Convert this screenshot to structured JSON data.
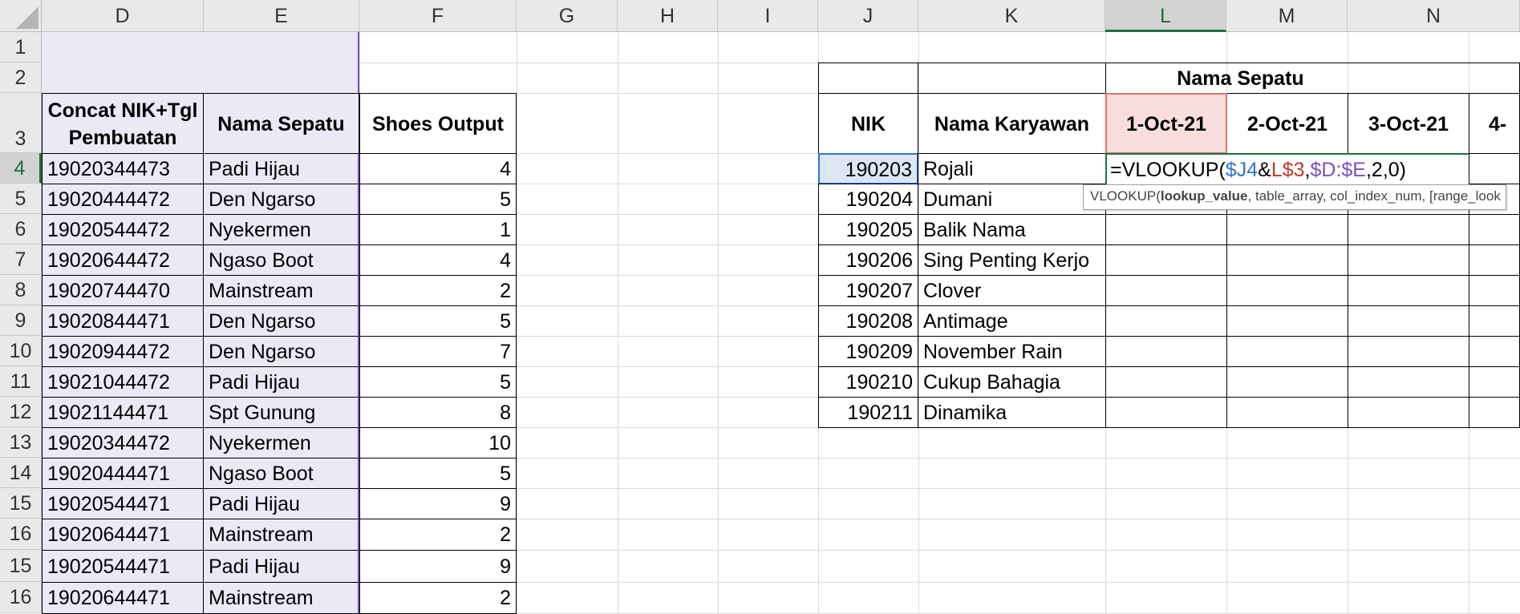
{
  "sheet": {
    "columns": [
      "D",
      "E",
      "F",
      "G",
      "H",
      "I",
      "J",
      "K",
      "L",
      "M",
      "N"
    ],
    "selected_column": "L",
    "rows": [
      "1",
      "2",
      "3",
      "4",
      "5",
      "6",
      "7",
      "8",
      "9",
      "10",
      "11",
      "12",
      "13",
      "14",
      "15",
      "16",
      "15",
      "16"
    ],
    "selected_row": "4"
  },
  "left_table": {
    "headers": [
      "Concat NIK+Tgl Pembuatan",
      "Nama Sepatu",
      "Shoes Output"
    ],
    "rows": [
      [
        "19020344473",
        "Padi Hijau",
        "4"
      ],
      [
        "19020444472",
        "Den Ngarso",
        "5"
      ],
      [
        "19020544472",
        "Nyekermen",
        "1"
      ],
      [
        "19020644472",
        "Ngaso Boot",
        "4"
      ],
      [
        "19020744470",
        "Mainstream",
        "2"
      ],
      [
        "19020844471",
        "Den Ngarso",
        "5"
      ],
      [
        "19020944472",
        "Den Ngarso",
        "7"
      ],
      [
        "19021044472",
        "Padi Hijau",
        "5"
      ],
      [
        "19021144471",
        "Spt Gunung",
        "8"
      ],
      [
        "19020344472",
        "Nyekermen",
        "10"
      ],
      [
        "19020444471",
        "Ngaso Boot",
        "5"
      ],
      [
        "19020544471",
        "Padi Hijau",
        "9"
      ],
      [
        "19020644471",
        "Mainstream",
        "2"
      ],
      [
        "19020544471",
        "Padi Hijau",
        "9"
      ],
      [
        "19020644471",
        "Mainstream",
        "2"
      ]
    ]
  },
  "right_table": {
    "group_header": "Nama Sepatu",
    "nik_header": "NIK",
    "name_header": "Nama Karyawan",
    "date_headers": [
      "1-Oct-21",
      "2-Oct-21",
      "3-Oct-21",
      "4-"
    ],
    "rows": [
      [
        "190203",
        "Rojali"
      ],
      [
        "190204",
        "Dumani"
      ],
      [
        "190205",
        "Balik Nama"
      ],
      [
        "190206",
        "Sing Penting Kerjo"
      ],
      [
        "190207",
        "Clover"
      ],
      [
        "190208",
        "Antimage"
      ],
      [
        "190209",
        "November Rain"
      ],
      [
        "190210",
        "Cukup Bahagia"
      ],
      [
        "190211",
        "Dinamika"
      ]
    ]
  },
  "formula": {
    "prefix": "=VLOOKUP(",
    "ref1": "$J4",
    "amp": "&",
    "ref2": "L$3",
    "comma1": ",",
    "ref3": "$D:$E",
    "suffix": ",2,0)"
  },
  "tooltip": {
    "fn": "VLOOKUP(",
    "arg1": "lookup_value",
    "rest": ", table_array, col_index_num, [range_look"
  }
}
